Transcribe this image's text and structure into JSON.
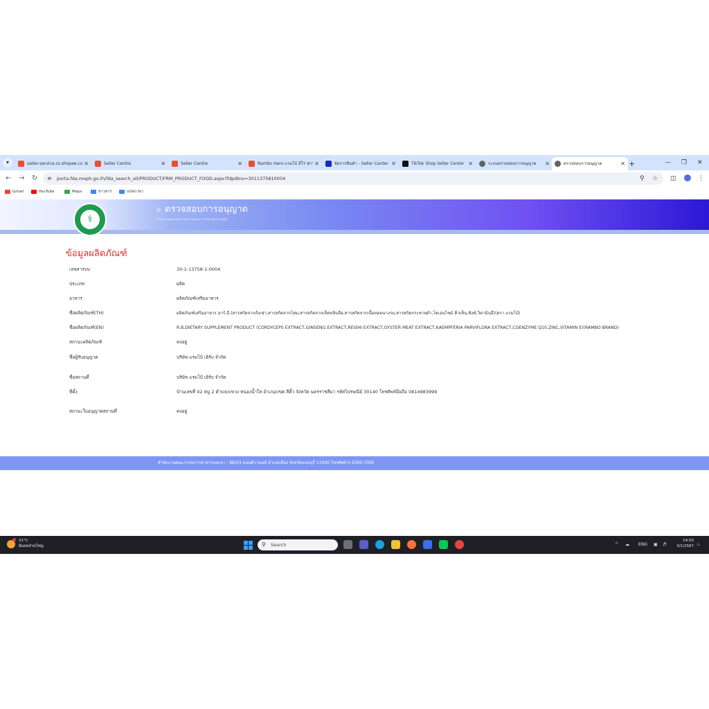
{
  "browser": {
    "tabs": [
      {
        "title": "seller-service.cs.shopee.co",
        "color": "#ee4d2d"
      },
      {
        "title": "Seller Centre",
        "color": "#ee4d2d"
      },
      {
        "title": "Seller Centre",
        "color": "#ee4d2d"
      },
      {
        "title": "Rambo Hero แรมโบ้ ฮีโร่ ฟาร์มา",
        "color": "#ee4d2d"
      },
      {
        "title": "จัดการสินค้า - Seller Center",
        "color": "#1a2bb8"
      },
      {
        "title": "TikTok Shop Seller Center",
        "color": "#111111"
      },
      {
        "title": "ระบบตรวจสอบการอนุญาต",
        "color": "#5f6368"
      },
      {
        "title": "ตรวจสอบการอนุญาต",
        "color": "#5f6368"
      }
    ],
    "url": "porta.fda.moph.go.th/fda_search_all/PRODUCT/FRM_PRODUCT_FOOD.aspx?fdpdtno=3011375810004",
    "bookmarks": [
      "Gmail",
      "YouTube",
      "Maps",
      "ข่าวสาร",
      "แปลภาษา"
    ],
    "bookmark_colors": [
      "#ea4335",
      "#ff0000",
      "#34a853",
      "#4285f4",
      "#4285f4"
    ]
  },
  "banner": {
    "title": "ตรวจสอบการอนุญาต",
    "subtitle": "สำนักงานคณะกรรมการอาหารและยา กระทรวงสาธารณสุข",
    "logo_text": "กระทรวงสาธารณสุข"
  },
  "product": {
    "section_title": "ข้อมูลผลิตภัณฑ์",
    "rows": [
      {
        "label": "เลขสารบบ",
        "value": "30-1-13758-1-0004"
      },
      {
        "label": "ประเภท",
        "value": "ผลิต"
      },
      {
        "label": "อาหาร",
        "value": "ผลิตภัณฑ์เสริมอาหาร"
      },
      {
        "label": "ชื่อผลิตภัณฑ์(TH)",
        "value": "ผลิตภัณฑ์เสริมอาหาร อาร์.บี.(สารสกัดจากถั่งเช่า,สารสกัดจากโสม,สารสกัดจากเห็ดหลินจือ,สารสกัดจากเนื้อหอยนางรม,สารสกัดกระชายดำ,โคเอนไซม์ คิวเท็น,ซิงค์,วิตามินอี)(ตรา แรมโบ้)"
      },
      {
        "label": "ชื่อผลิตภัณฑ์(EN)",
        "value": "R.B.DIETARY SUPPLEMENT PRODUCT (CORDYCEPS EXTRACT,GINSENG EXTRACT,REISHI EXTRACT,OYSTER MEAT EXTRACT,KAEMPFERIA PARVIFLORA EXTRACT,COENZYME Q10,ZINC,VITAMIN E)(RAMBO BRAND)"
      },
      {
        "label": "สถานะผลิตภัณฑ์",
        "value": "คงอยู่"
      },
      {
        "label": "ชื่อผู้รับอนุญาต",
        "value": "บริษัท แรมโบ้ เฮิร์บ จำกัด"
      },
      {
        "label": "ชื่อสถานที่",
        "value": "บริษัท แรมโบ้ เฮิร์บ จำกัด"
      },
      {
        "label": "ที่ตั้ง",
        "value": "บ้านเลขที่ 42 หมู่ 2 ตำบล/แขวง หนองน้ำใส อำเภอ/เขต สีคิ้ว จังหวัด นครราชสีมา รหัสไปรษณีย์ 30140 โทรศัพท์มือถือ 0814983999"
      },
      {
        "label": "สถานะใบอนุญาตสถานที่",
        "value": "คงอยู่"
      }
    ]
  },
  "footer": {
    "text": "สำนักงานคณะกรรมการอาหารและยา : 88/24 ถนนติวานนท์ อำเภอเมือง จังหวัดนนทบุรี 11000 โทรศัพท์ 0-2590-7000"
  },
  "taskbar": {
    "weather_temp": "31°C",
    "weather_desc": "มีแดดส่วนใหญ่",
    "search_placeholder": "Search",
    "language": "ENG",
    "time": "14:50",
    "date": "3/1/2567"
  }
}
